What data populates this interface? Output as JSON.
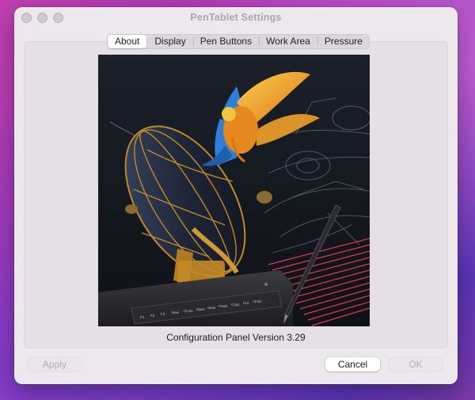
{
  "window": {
    "title": "PenTablet Settings"
  },
  "tabs": [
    {
      "label": "About",
      "active": true
    },
    {
      "label": "Display",
      "active": false
    },
    {
      "label": "Pen Buttons",
      "active": false
    },
    {
      "label": "Work Area",
      "active": false
    },
    {
      "label": "Pressure",
      "active": false
    }
  ],
  "about": {
    "caption": "Configuration Panel Version 3.29",
    "tablet_keys": [
      "F1",
      "F2",
      "F3",
      "New",
      "Close",
      "Open",
      "Save",
      "Paste",
      "Copy",
      "Cut",
      "Undo"
    ]
  },
  "buttons": {
    "apply": "Apply",
    "cancel": "Cancel",
    "ok": "OK"
  },
  "colors": {
    "accent_laser": "#e0394c",
    "parrot_blue": "#2f7fd8",
    "parrot_orange": "#f0a12a"
  }
}
